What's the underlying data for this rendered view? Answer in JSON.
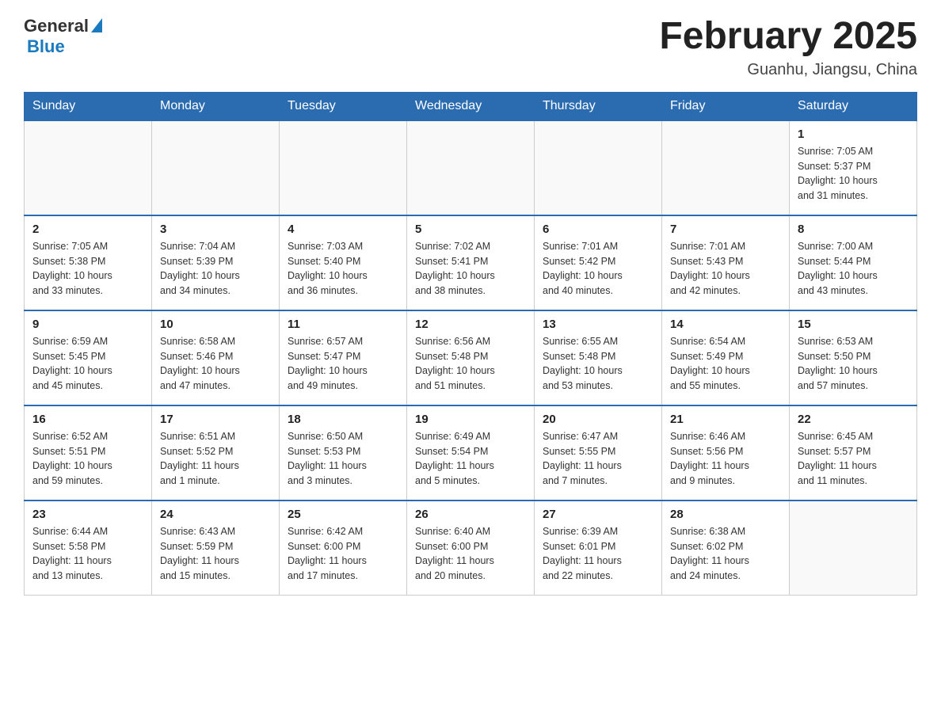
{
  "header": {
    "logo_general": "General",
    "logo_blue": "Blue",
    "title": "February 2025",
    "location": "Guanhu, Jiangsu, China"
  },
  "days_of_week": [
    "Sunday",
    "Monday",
    "Tuesday",
    "Wednesday",
    "Thursday",
    "Friday",
    "Saturday"
  ],
  "weeks": [
    {
      "days": [
        {
          "num": "",
          "info": ""
        },
        {
          "num": "",
          "info": ""
        },
        {
          "num": "",
          "info": ""
        },
        {
          "num": "",
          "info": ""
        },
        {
          "num": "",
          "info": ""
        },
        {
          "num": "",
          "info": ""
        },
        {
          "num": "1",
          "info": "Sunrise: 7:05 AM\nSunset: 5:37 PM\nDaylight: 10 hours\nand 31 minutes."
        }
      ]
    },
    {
      "days": [
        {
          "num": "2",
          "info": "Sunrise: 7:05 AM\nSunset: 5:38 PM\nDaylight: 10 hours\nand 33 minutes."
        },
        {
          "num": "3",
          "info": "Sunrise: 7:04 AM\nSunset: 5:39 PM\nDaylight: 10 hours\nand 34 minutes."
        },
        {
          "num": "4",
          "info": "Sunrise: 7:03 AM\nSunset: 5:40 PM\nDaylight: 10 hours\nand 36 minutes."
        },
        {
          "num": "5",
          "info": "Sunrise: 7:02 AM\nSunset: 5:41 PM\nDaylight: 10 hours\nand 38 minutes."
        },
        {
          "num": "6",
          "info": "Sunrise: 7:01 AM\nSunset: 5:42 PM\nDaylight: 10 hours\nand 40 minutes."
        },
        {
          "num": "7",
          "info": "Sunrise: 7:01 AM\nSunset: 5:43 PM\nDaylight: 10 hours\nand 42 minutes."
        },
        {
          "num": "8",
          "info": "Sunrise: 7:00 AM\nSunset: 5:44 PM\nDaylight: 10 hours\nand 43 minutes."
        }
      ]
    },
    {
      "days": [
        {
          "num": "9",
          "info": "Sunrise: 6:59 AM\nSunset: 5:45 PM\nDaylight: 10 hours\nand 45 minutes."
        },
        {
          "num": "10",
          "info": "Sunrise: 6:58 AM\nSunset: 5:46 PM\nDaylight: 10 hours\nand 47 minutes."
        },
        {
          "num": "11",
          "info": "Sunrise: 6:57 AM\nSunset: 5:47 PM\nDaylight: 10 hours\nand 49 minutes."
        },
        {
          "num": "12",
          "info": "Sunrise: 6:56 AM\nSunset: 5:48 PM\nDaylight: 10 hours\nand 51 minutes."
        },
        {
          "num": "13",
          "info": "Sunrise: 6:55 AM\nSunset: 5:48 PM\nDaylight: 10 hours\nand 53 minutes."
        },
        {
          "num": "14",
          "info": "Sunrise: 6:54 AM\nSunset: 5:49 PM\nDaylight: 10 hours\nand 55 minutes."
        },
        {
          "num": "15",
          "info": "Sunrise: 6:53 AM\nSunset: 5:50 PM\nDaylight: 10 hours\nand 57 minutes."
        }
      ]
    },
    {
      "days": [
        {
          "num": "16",
          "info": "Sunrise: 6:52 AM\nSunset: 5:51 PM\nDaylight: 10 hours\nand 59 minutes."
        },
        {
          "num": "17",
          "info": "Sunrise: 6:51 AM\nSunset: 5:52 PM\nDaylight: 11 hours\nand 1 minute."
        },
        {
          "num": "18",
          "info": "Sunrise: 6:50 AM\nSunset: 5:53 PM\nDaylight: 11 hours\nand 3 minutes."
        },
        {
          "num": "19",
          "info": "Sunrise: 6:49 AM\nSunset: 5:54 PM\nDaylight: 11 hours\nand 5 minutes."
        },
        {
          "num": "20",
          "info": "Sunrise: 6:47 AM\nSunset: 5:55 PM\nDaylight: 11 hours\nand 7 minutes."
        },
        {
          "num": "21",
          "info": "Sunrise: 6:46 AM\nSunset: 5:56 PM\nDaylight: 11 hours\nand 9 minutes."
        },
        {
          "num": "22",
          "info": "Sunrise: 6:45 AM\nSunset: 5:57 PM\nDaylight: 11 hours\nand 11 minutes."
        }
      ]
    },
    {
      "days": [
        {
          "num": "23",
          "info": "Sunrise: 6:44 AM\nSunset: 5:58 PM\nDaylight: 11 hours\nand 13 minutes."
        },
        {
          "num": "24",
          "info": "Sunrise: 6:43 AM\nSunset: 5:59 PM\nDaylight: 11 hours\nand 15 minutes."
        },
        {
          "num": "25",
          "info": "Sunrise: 6:42 AM\nSunset: 6:00 PM\nDaylight: 11 hours\nand 17 minutes."
        },
        {
          "num": "26",
          "info": "Sunrise: 6:40 AM\nSunset: 6:00 PM\nDaylight: 11 hours\nand 20 minutes."
        },
        {
          "num": "27",
          "info": "Sunrise: 6:39 AM\nSunset: 6:01 PM\nDaylight: 11 hours\nand 22 minutes."
        },
        {
          "num": "28",
          "info": "Sunrise: 6:38 AM\nSunset: 6:02 PM\nDaylight: 11 hours\nand 24 minutes."
        },
        {
          "num": "",
          "info": ""
        }
      ]
    }
  ]
}
